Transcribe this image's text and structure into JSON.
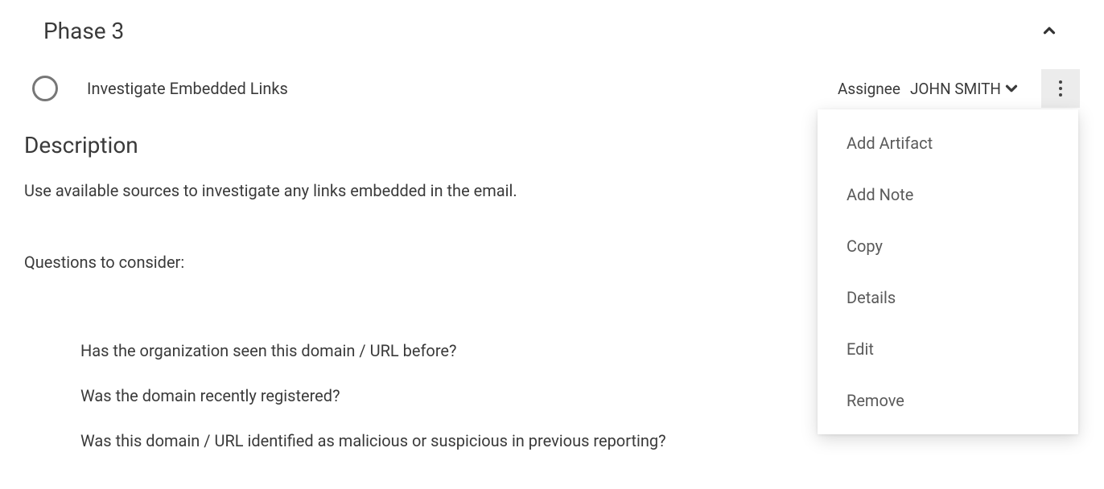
{
  "phase": {
    "title": "Phase 3"
  },
  "task": {
    "title": "Investigate Embedded Links",
    "assignee_label": "Assignee",
    "assignee_value": "JOHN SMITH"
  },
  "description": {
    "heading": "Description",
    "body": "Use available sources to investigate any links embedded in the email.",
    "questions_label": "Questions to consider:",
    "questions": [
      "Has the organization seen this domain / URL before?",
      "Was the domain recently registered?",
      "Was this domain / URL identified as malicious or suspicious in previous reporting?"
    ]
  },
  "menu": {
    "items": [
      "Add Artifact",
      "Add Note",
      "Copy",
      "Details",
      "Edit",
      "Remove"
    ]
  }
}
